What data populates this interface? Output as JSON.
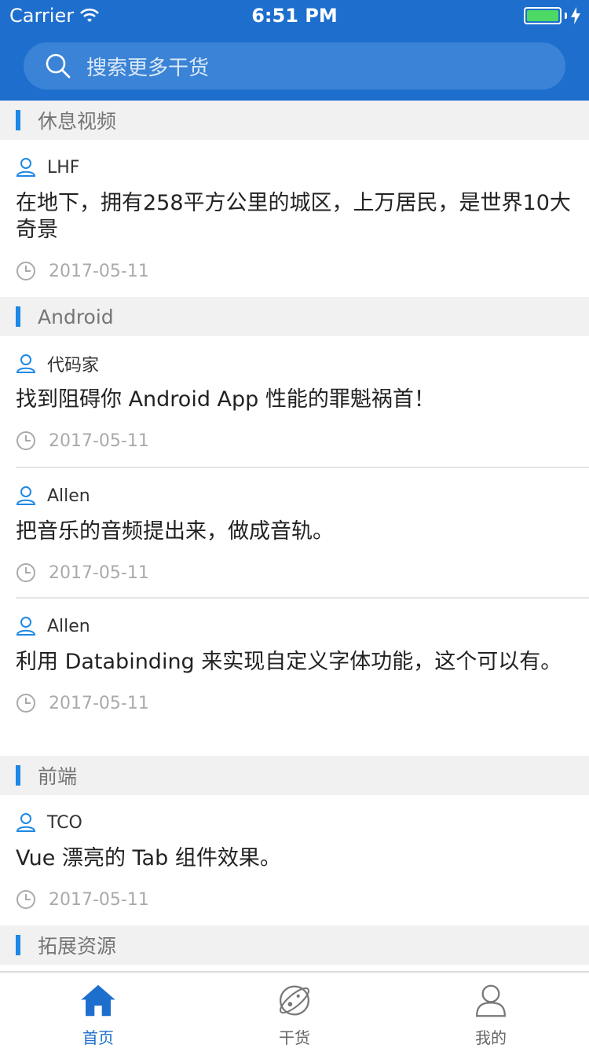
{
  "status_bar": {
    "carrier": "Carrier",
    "time": "6:51 PM",
    "battery_level": 1.0
  },
  "search": {
    "placeholder": "搜索更多干货"
  },
  "colors": {
    "accent": "#1e6fcd",
    "section_bar": "#1e88e5",
    "battery": "#4cd964"
  },
  "sections": [
    {
      "title": "休息视频",
      "items": [
        {
          "author": "LHF",
          "title": "在地下，拥有258平方公里的城区，上万居民，是世界10大奇景",
          "date": "2017-05-11"
        }
      ]
    },
    {
      "title": "Android",
      "items": [
        {
          "author": "代码家",
          "title": "找到阻碍你 Android App 性能的罪魁祸首！",
          "date": "2017-05-11"
        },
        {
          "author": "Allen",
          "title": "把音乐的音频提出来，做成音轨。",
          "date": "2017-05-11"
        },
        {
          "author": "Allen",
          "title": "利用 Databinding 来实现自定义字体功能，这个可以有。",
          "date": "2017-05-11"
        }
      ]
    },
    {
      "title": "前端",
      "items": [
        {
          "author": "TCO",
          "title": "Vue 漂亮的 Tab 组件效果。",
          "date": "2017-05-11"
        }
      ]
    },
    {
      "title": "拓展资源",
      "items": []
    }
  ],
  "tabbar": {
    "tabs": [
      {
        "label": "首页",
        "icon": "home-icon",
        "active": true
      },
      {
        "label": "干货",
        "icon": "planet-icon",
        "active": false
      },
      {
        "label": "我的",
        "icon": "person-icon",
        "active": false
      }
    ]
  }
}
